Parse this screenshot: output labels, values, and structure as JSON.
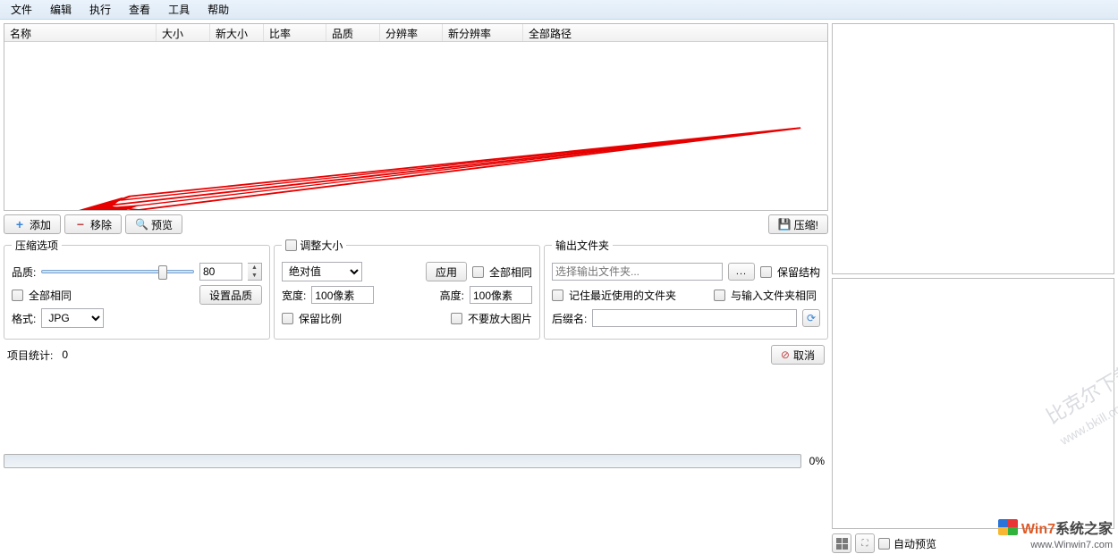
{
  "menu": {
    "file": "文件",
    "edit": "编辑",
    "run": "执行",
    "view": "查看",
    "tools": "工具",
    "help": "帮助"
  },
  "columns": {
    "name": "名称",
    "size": "大小",
    "newsize": "新大小",
    "ratio": "比率",
    "quality": "品质",
    "res": "分辨率",
    "newres": "新分辨率",
    "path": "全部路径"
  },
  "actions": {
    "add": "添加",
    "remove": "移除",
    "preview": "预览",
    "compress": "压缩!"
  },
  "compress": {
    "legend": "压缩选项",
    "quality_label": "品质:",
    "quality_value": "80",
    "slider_percent": 80,
    "all_same": "全部相同",
    "set_quality": "设置品质",
    "format_label": "格式:",
    "format_value": "JPG"
  },
  "resize": {
    "legend": "调整大小",
    "mode": "绝对值",
    "apply": "应用",
    "all_same": "全部相同",
    "width_label": "宽度:",
    "width_value": "100像素",
    "height_label": "高度:",
    "height_value": "100像素",
    "keep_ratio": "保留比例",
    "no_upscale": "不要放大图片"
  },
  "output": {
    "legend": "输出文件夹",
    "placeholder": "选择输出文件夹...",
    "keep_struct": "保留结构",
    "remember": "记住最近使用的文件夹",
    "same_as_input": "与输入文件夹相同",
    "suffix_label": "后缀名:",
    "suffix_value": ""
  },
  "status": {
    "count_label": "项目统计:",
    "count": "0",
    "cancel": "取消",
    "progress": "0%"
  },
  "right": {
    "auto_preview": "自动预览"
  },
  "watermark1": "比克尔下载",
  "watermark2": "下载",
  "watermark_url": "www.bkill.com",
  "brand_pre": "Win7",
  "brand_suf": "系统之家",
  "brand_url": "www.Winwin7.com"
}
